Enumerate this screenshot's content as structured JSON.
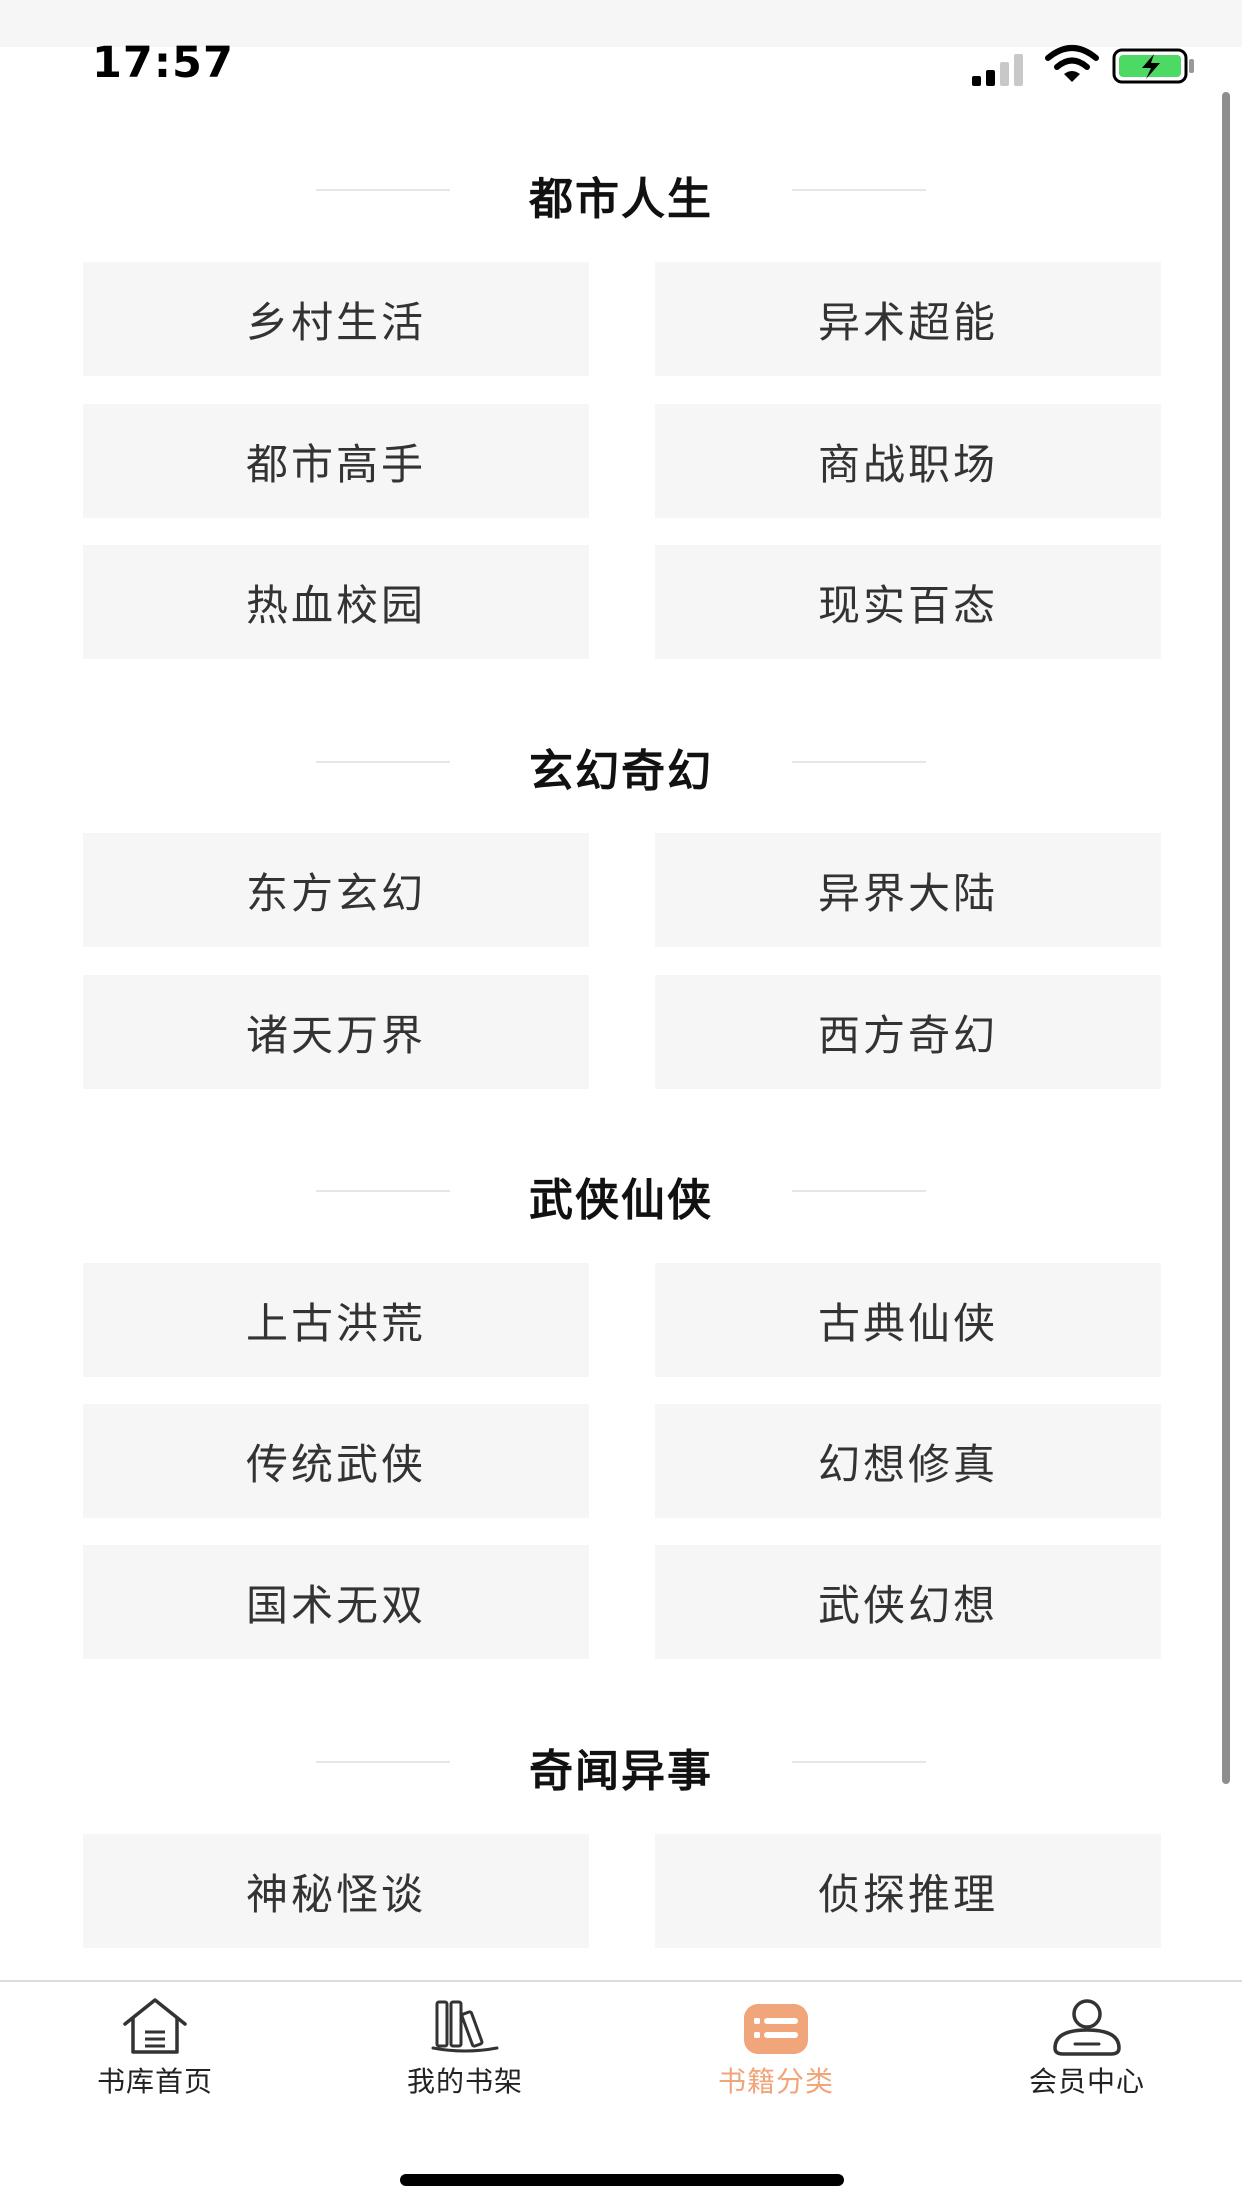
{
  "status_bar": {
    "time": "17:57"
  },
  "sections": [
    {
      "title": "都市人生",
      "items": [
        "乡村生活",
        "异术超能",
        "都市高手",
        "商战职场",
        "热血校园",
        "现实百态"
      ]
    },
    {
      "title": "玄幻奇幻",
      "items": [
        "东方玄幻",
        "异界大陆",
        "诸天万界",
        "西方奇幻"
      ]
    },
    {
      "title": "武侠仙侠",
      "items": [
        "上古洪荒",
        "古典仙侠",
        "传统武侠",
        "幻想修真",
        "国术无双",
        "武侠幻想"
      ]
    },
    {
      "title": "奇闻异事",
      "items": [
        "神秘怪谈",
        "侦探推理"
      ]
    }
  ],
  "tabbar": {
    "items": [
      {
        "label": "书库首页",
        "icon": "home-icon",
        "active": false
      },
      {
        "label": "我的书架",
        "icon": "bookshelf-icon",
        "active": false
      },
      {
        "label": "书籍分类",
        "icon": "category-icon",
        "active": true
      },
      {
        "label": "会员中心",
        "icon": "user-icon",
        "active": false
      }
    ]
  },
  "colors": {
    "accent": "#f0a57a",
    "tile_bg": "#f6f6f6",
    "divider": "#e6e6e6"
  }
}
